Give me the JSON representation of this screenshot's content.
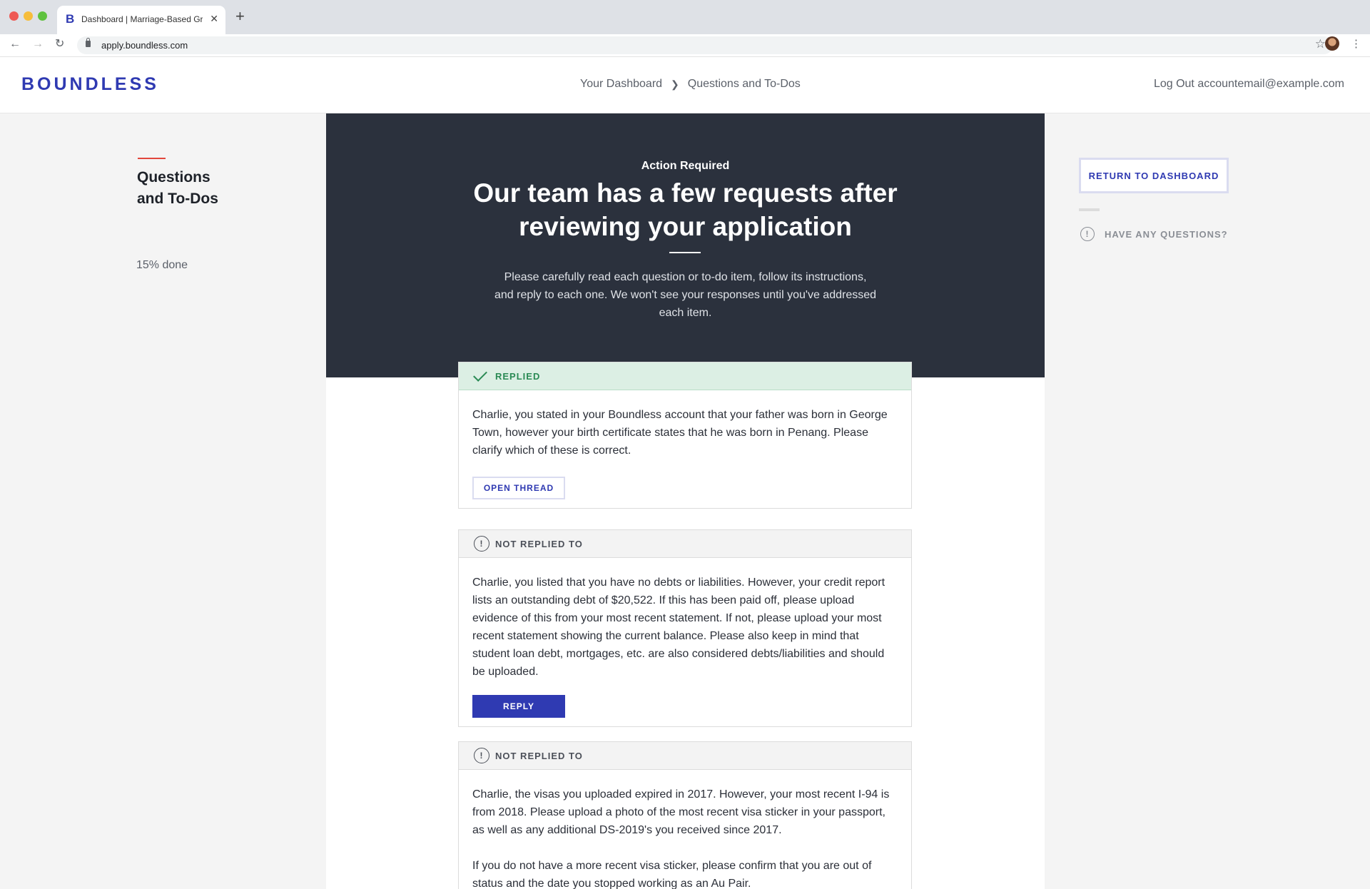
{
  "browser": {
    "tab_title": "Dashboard | Marriage-Based Gre",
    "url": "apply.boundless.com"
  },
  "header": {
    "logo": "BOUNDLESS",
    "breadcrumb": [
      "Your Dashboard",
      "Questions and To-Dos"
    ],
    "logout_label": "Log Out",
    "account_email": "accountemail@example.com"
  },
  "left": {
    "title_line1": "Questions",
    "title_line2": "and To-Dos",
    "progress": "15% done"
  },
  "right": {
    "return_label": "RETURN TO DASHBOARD",
    "questions_label": "HAVE ANY QUESTIONS?"
  },
  "hero": {
    "kicker": "Action Required",
    "title": "Our team has a few requests after reviewing your application",
    "body": "Please carefully read each question or to-do item, follow its instructions, and reply to each one. We won't see your responses until you've addressed each item."
  },
  "cards": [
    {
      "status": "REPLIED",
      "paragraphs": [
        "Charlie, you stated in your Boundless account that your father was born in George Town, however your birth certificate states that he was born in Penang. Please clarify which of these is correct."
      ],
      "action": "OPEN THREAD"
    },
    {
      "status": "NOT REPLIED TO",
      "paragraphs": [
        "Charlie, you listed that you have no debts or liabilities. However, your credit report lists an outstanding debt of $20,522. If this has been paid off, please upload evidence of this from your most recent statement. If not, please upload your most recent statement showing the current balance. Please also keep in mind that student loan debt, mortgages, etc. are also considered debts/liabilities and should be uploaded."
      ],
      "action": "REPLY"
    },
    {
      "status": "NOT REPLIED TO",
      "paragraphs": [
        "Charlie, the visas you uploaded expired in 2017. However, your most recent I-94 is from 2018. Please upload a photo of the most recent visa sticker in your passport, as well as any additional DS-2019's you received since 2017.",
        "If you do not have a more recent visa sticker, please confirm that you are out of status and the date you stopped working as an Au Pair."
      ]
    }
  ]
}
